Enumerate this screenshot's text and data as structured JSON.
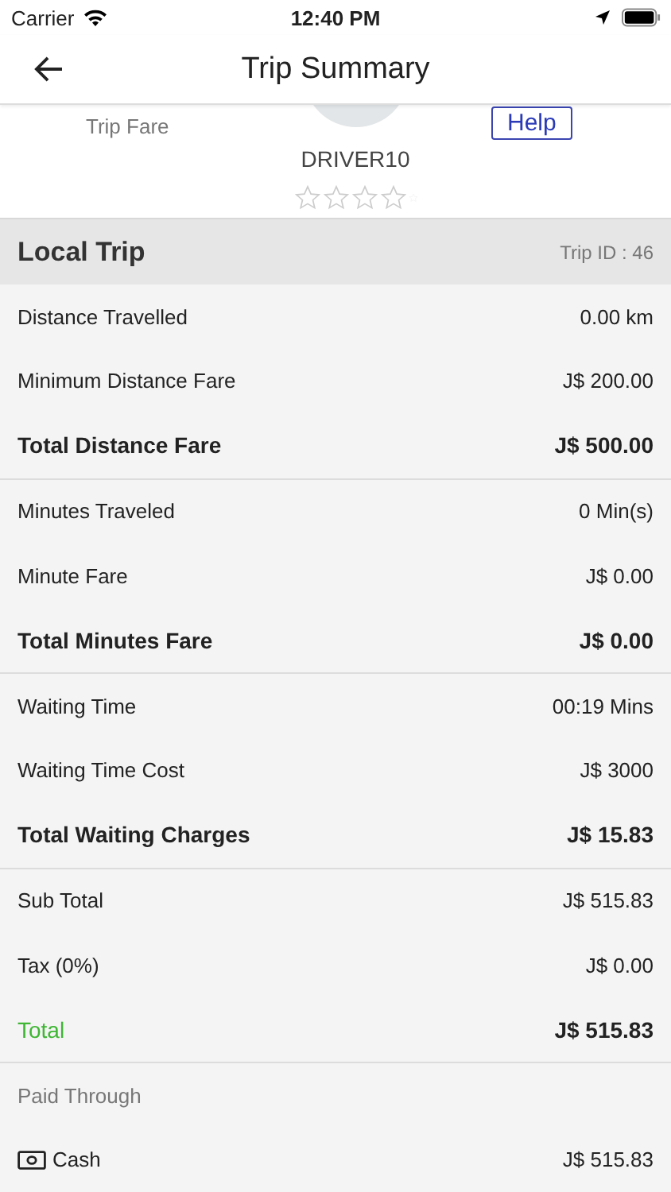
{
  "status_bar": {
    "carrier": "Carrier",
    "time": "12:40 PM"
  },
  "header": {
    "title": "Trip Summary"
  },
  "profile": {
    "fare_label": "Trip Fare",
    "driver": "DRIVER10",
    "help": "Help",
    "stars": 0
  },
  "trip": {
    "title": "Local Trip",
    "trip_id": "Trip ID : 46"
  },
  "groups": [
    {
      "rows": [
        {
          "label": "Distance Travelled",
          "value": "0.00 km",
          "kind": "normal"
        },
        {
          "label": "Minimum Distance Fare",
          "value": "J$ 200.00",
          "kind": "normal"
        },
        {
          "label": "Total Distance Fare",
          "value": "J$ 500.00",
          "kind": "bold"
        }
      ]
    },
    {
      "rows": [
        {
          "label": "Minutes Traveled",
          "value": "0 Min(s)",
          "kind": "normal"
        },
        {
          "label": "Minute Fare",
          "value": "J$ 0.00",
          "kind": "normal"
        },
        {
          "label": "Total Minutes Fare",
          "value": "J$ 0.00",
          "kind": "bold"
        }
      ]
    },
    {
      "rows": [
        {
          "label": "Waiting Time",
          "value": "00:19 Mins",
          "kind": "normal"
        },
        {
          "label": "Waiting Time Cost",
          "value": "J$ 3000",
          "kind": "normal"
        },
        {
          "label": "Total Waiting Charges",
          "value": "J$ 15.83",
          "kind": "bold"
        }
      ]
    },
    {
      "rows": [
        {
          "label": "Sub Total",
          "value": "J$ 515.83",
          "kind": "normal"
        },
        {
          "label": "Tax (0%)",
          "value": "J$ 0.00",
          "kind": "normal"
        },
        {
          "label": "Total",
          "value": "J$ 515.83",
          "kind": "total"
        }
      ]
    },
    {
      "rows": [
        {
          "label": "Paid Through",
          "kind": "caption"
        },
        {
          "label": "Cash",
          "value": "J$ 515.83",
          "kind": "cash"
        }
      ]
    }
  ]
}
